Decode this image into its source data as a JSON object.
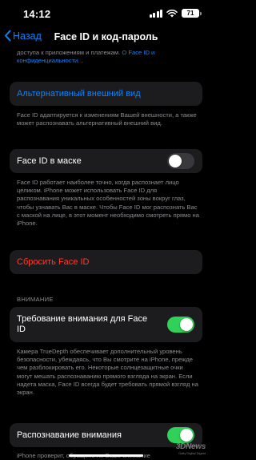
{
  "status_bar": {
    "time": "14:12",
    "battery": "71"
  },
  "nav": {
    "back_label": "Назад",
    "title": "Face ID и код-пароль"
  },
  "intro": {
    "text_before_link": "доступа к приложениям и платежам. ",
    "link_text": "О Face ID и конфиденциальности…"
  },
  "alt_appearance": {
    "label": "Альтернативный внешний вид",
    "footer": "Face ID адаптируется к изменениям Вашей внешности, а также может распознавать альтернативный внешний вид."
  },
  "mask": {
    "label": "Face ID в маске",
    "enabled": false,
    "footer": "Face ID работает наиболее точно, когда распознает лицо целиком. iPhone может использовать Face ID для распознавания уникальных особенностей зоны вокруг глаз, чтобы узнавать Вас в маске. Чтобы Face ID мог распознать Вас с маской на лице, в этот момент необходимо смотреть прямо на iPhone."
  },
  "reset": {
    "label": "Сбросить Face ID"
  },
  "attention_section": {
    "header": "ВНИМАНИЕ",
    "require_label": "Требование внимания для Face ID",
    "require_enabled": true,
    "require_footer": "Камера TrueDepth обеспечивает дополнительный уровень безопасности, убеждаясь, что Вы смотрите на iPhone, прежде чем разблокировать его. Некоторые солнцезащитные очки могут мешать распознаванию прямого взгляда на экран. Если надета маска, Face ID всегда будет требовать прямой взгляд на экран.",
    "aware_label": "Распознавание внимания",
    "aware_enabled": true,
    "aware_footer": "iPhone проверит, обращено ли Ваше внимание"
  },
  "watermark": {
    "brand": "3DNews",
    "tagline": "Daily Digital Digest"
  },
  "icons": {
    "back": "chevron-left-icon",
    "signal": "cellular-signal-icon",
    "wifi": "wifi-icon",
    "battery": "battery-icon"
  },
  "colors": {
    "accent": "#0a84ff",
    "destructive": "#ff3b30",
    "toggle_on": "#30d158",
    "cell_bg": "#1c1c1e"
  }
}
